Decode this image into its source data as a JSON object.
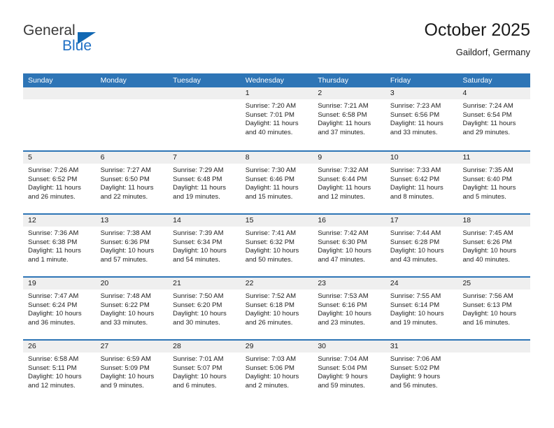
{
  "brand": {
    "name_part1": "General",
    "name_part2": "Blue",
    "accent_color": "#1268b3"
  },
  "header": {
    "title": "October 2025",
    "subtitle": "Gaildorf, Germany",
    "header_bg_color": "#2e75b6",
    "band_color": "#efefef"
  },
  "weekdays": [
    "Sunday",
    "Monday",
    "Tuesday",
    "Wednesday",
    "Thursday",
    "Friday",
    "Saturday"
  ],
  "weeks": [
    [
      {
        "day": "",
        "sunrise": "",
        "sunset": "",
        "daylight1": "",
        "daylight2": "",
        "empty": true
      },
      {
        "day": "",
        "sunrise": "",
        "sunset": "",
        "daylight1": "",
        "daylight2": "",
        "empty": true
      },
      {
        "day": "",
        "sunrise": "",
        "sunset": "",
        "daylight1": "",
        "daylight2": "",
        "empty": true
      },
      {
        "day": "1",
        "sunrise": "Sunrise: 7:20 AM",
        "sunset": "Sunset: 7:01 PM",
        "daylight1": "Daylight: 11 hours",
        "daylight2": "and 40 minutes."
      },
      {
        "day": "2",
        "sunrise": "Sunrise: 7:21 AM",
        "sunset": "Sunset: 6:58 PM",
        "daylight1": "Daylight: 11 hours",
        "daylight2": "and 37 minutes."
      },
      {
        "day": "3",
        "sunrise": "Sunrise: 7:23 AM",
        "sunset": "Sunset: 6:56 PM",
        "daylight1": "Daylight: 11 hours",
        "daylight2": "and 33 minutes."
      },
      {
        "day": "4",
        "sunrise": "Sunrise: 7:24 AM",
        "sunset": "Sunset: 6:54 PM",
        "daylight1": "Daylight: 11 hours",
        "daylight2": "and 29 minutes."
      }
    ],
    [
      {
        "day": "5",
        "sunrise": "Sunrise: 7:26 AM",
        "sunset": "Sunset: 6:52 PM",
        "daylight1": "Daylight: 11 hours",
        "daylight2": "and 26 minutes."
      },
      {
        "day": "6",
        "sunrise": "Sunrise: 7:27 AM",
        "sunset": "Sunset: 6:50 PM",
        "daylight1": "Daylight: 11 hours",
        "daylight2": "and 22 minutes."
      },
      {
        "day": "7",
        "sunrise": "Sunrise: 7:29 AM",
        "sunset": "Sunset: 6:48 PM",
        "daylight1": "Daylight: 11 hours",
        "daylight2": "and 19 minutes."
      },
      {
        "day": "8",
        "sunrise": "Sunrise: 7:30 AM",
        "sunset": "Sunset: 6:46 PM",
        "daylight1": "Daylight: 11 hours",
        "daylight2": "and 15 minutes."
      },
      {
        "day": "9",
        "sunrise": "Sunrise: 7:32 AM",
        "sunset": "Sunset: 6:44 PM",
        "daylight1": "Daylight: 11 hours",
        "daylight2": "and 12 minutes."
      },
      {
        "day": "10",
        "sunrise": "Sunrise: 7:33 AM",
        "sunset": "Sunset: 6:42 PM",
        "daylight1": "Daylight: 11 hours",
        "daylight2": "and 8 minutes."
      },
      {
        "day": "11",
        "sunrise": "Sunrise: 7:35 AM",
        "sunset": "Sunset: 6:40 PM",
        "daylight1": "Daylight: 11 hours",
        "daylight2": "and 5 minutes."
      }
    ],
    [
      {
        "day": "12",
        "sunrise": "Sunrise: 7:36 AM",
        "sunset": "Sunset: 6:38 PM",
        "daylight1": "Daylight: 11 hours",
        "daylight2": "and 1 minute."
      },
      {
        "day": "13",
        "sunrise": "Sunrise: 7:38 AM",
        "sunset": "Sunset: 6:36 PM",
        "daylight1": "Daylight: 10 hours",
        "daylight2": "and 57 minutes."
      },
      {
        "day": "14",
        "sunrise": "Sunrise: 7:39 AM",
        "sunset": "Sunset: 6:34 PM",
        "daylight1": "Daylight: 10 hours",
        "daylight2": "and 54 minutes."
      },
      {
        "day": "15",
        "sunrise": "Sunrise: 7:41 AM",
        "sunset": "Sunset: 6:32 PM",
        "daylight1": "Daylight: 10 hours",
        "daylight2": "and 50 minutes."
      },
      {
        "day": "16",
        "sunrise": "Sunrise: 7:42 AM",
        "sunset": "Sunset: 6:30 PM",
        "daylight1": "Daylight: 10 hours",
        "daylight2": "and 47 minutes."
      },
      {
        "day": "17",
        "sunrise": "Sunrise: 7:44 AM",
        "sunset": "Sunset: 6:28 PM",
        "daylight1": "Daylight: 10 hours",
        "daylight2": "and 43 minutes."
      },
      {
        "day": "18",
        "sunrise": "Sunrise: 7:45 AM",
        "sunset": "Sunset: 6:26 PM",
        "daylight1": "Daylight: 10 hours",
        "daylight2": "and 40 minutes."
      }
    ],
    [
      {
        "day": "19",
        "sunrise": "Sunrise: 7:47 AM",
        "sunset": "Sunset: 6:24 PM",
        "daylight1": "Daylight: 10 hours",
        "daylight2": "and 36 minutes."
      },
      {
        "day": "20",
        "sunrise": "Sunrise: 7:48 AM",
        "sunset": "Sunset: 6:22 PM",
        "daylight1": "Daylight: 10 hours",
        "daylight2": "and 33 minutes."
      },
      {
        "day": "21",
        "sunrise": "Sunrise: 7:50 AM",
        "sunset": "Sunset: 6:20 PM",
        "daylight1": "Daylight: 10 hours",
        "daylight2": "and 30 minutes."
      },
      {
        "day": "22",
        "sunrise": "Sunrise: 7:52 AM",
        "sunset": "Sunset: 6:18 PM",
        "daylight1": "Daylight: 10 hours",
        "daylight2": "and 26 minutes."
      },
      {
        "day": "23",
        "sunrise": "Sunrise: 7:53 AM",
        "sunset": "Sunset: 6:16 PM",
        "daylight1": "Daylight: 10 hours",
        "daylight2": "and 23 minutes."
      },
      {
        "day": "24",
        "sunrise": "Sunrise: 7:55 AM",
        "sunset": "Sunset: 6:14 PM",
        "daylight1": "Daylight: 10 hours",
        "daylight2": "and 19 minutes."
      },
      {
        "day": "25",
        "sunrise": "Sunrise: 7:56 AM",
        "sunset": "Sunset: 6:13 PM",
        "daylight1": "Daylight: 10 hours",
        "daylight2": "and 16 minutes."
      }
    ],
    [
      {
        "day": "26",
        "sunrise": "Sunrise: 6:58 AM",
        "sunset": "Sunset: 5:11 PM",
        "daylight1": "Daylight: 10 hours",
        "daylight2": "and 12 minutes."
      },
      {
        "day": "27",
        "sunrise": "Sunrise: 6:59 AM",
        "sunset": "Sunset: 5:09 PM",
        "daylight1": "Daylight: 10 hours",
        "daylight2": "and 9 minutes."
      },
      {
        "day": "28",
        "sunrise": "Sunrise: 7:01 AM",
        "sunset": "Sunset: 5:07 PM",
        "daylight1": "Daylight: 10 hours",
        "daylight2": "and 6 minutes."
      },
      {
        "day": "29",
        "sunrise": "Sunrise: 7:03 AM",
        "sunset": "Sunset: 5:06 PM",
        "daylight1": "Daylight: 10 hours",
        "daylight2": "and 2 minutes."
      },
      {
        "day": "30",
        "sunrise": "Sunrise: 7:04 AM",
        "sunset": "Sunset: 5:04 PM",
        "daylight1": "Daylight: 9 hours",
        "daylight2": "and 59 minutes."
      },
      {
        "day": "31",
        "sunrise": "Sunrise: 7:06 AM",
        "sunset": "Sunset: 5:02 PM",
        "daylight1": "Daylight: 9 hours",
        "daylight2": "and 56 minutes."
      },
      {
        "day": "",
        "sunrise": "",
        "sunset": "",
        "daylight1": "",
        "daylight2": "",
        "empty": true
      }
    ]
  ]
}
